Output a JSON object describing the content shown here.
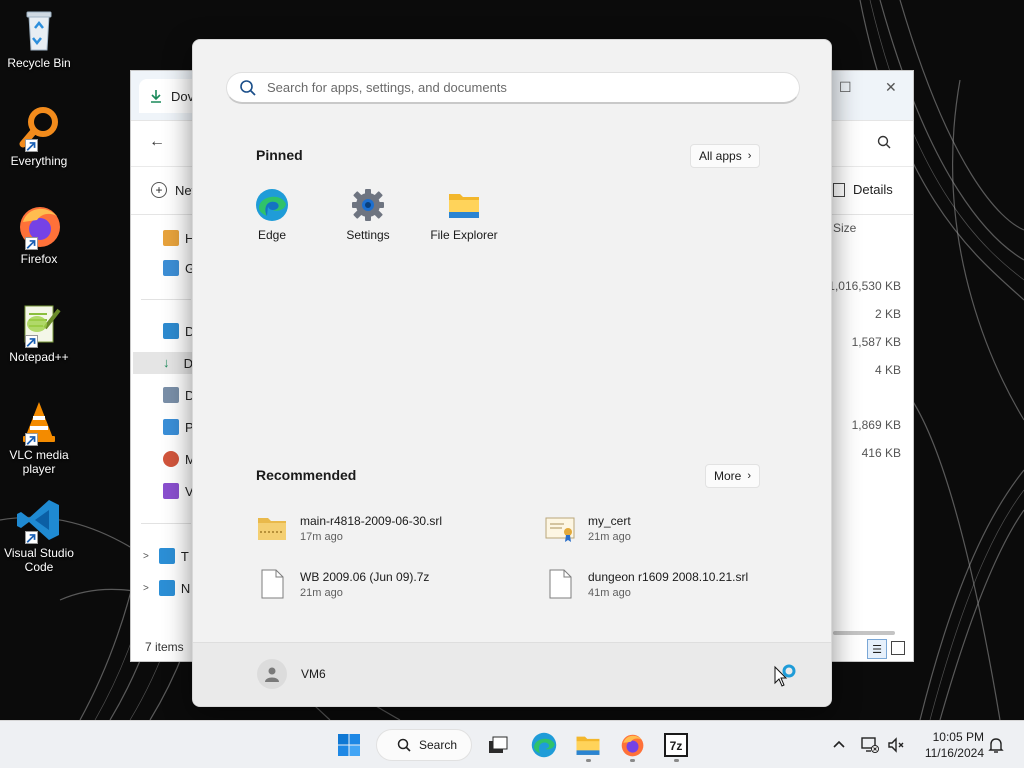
{
  "desktop": {
    "icons": [
      {
        "label": "Recycle Bin",
        "icon": "recycle-bin-icon"
      },
      {
        "label": "Everything",
        "icon": "everything-search-icon"
      },
      {
        "label": "Firefox",
        "icon": "firefox-icon"
      },
      {
        "label": "Notepad++",
        "icon": "notepad-plus-plus-icon"
      },
      {
        "label": "VLC media player",
        "icon": "vlc-icon"
      },
      {
        "label": "Visual Studio Code",
        "icon": "vscode-icon"
      }
    ]
  },
  "explorer": {
    "tab_title": "Dov",
    "new_label": "New",
    "details_label": "Details",
    "size_header": "Size",
    "nav_items": [
      "H",
      "G",
      "D",
      "D",
      "D",
      "P",
      "M",
      "V",
      "T",
      "N"
    ],
    "sizes": [
      "1,016,530 KB",
      "2 KB",
      "1,587 KB",
      "4 KB",
      "1,869 KB",
      "416 KB"
    ],
    "status": "7 items"
  },
  "start_menu": {
    "search_placeholder": "Search for apps, settings, and documents",
    "pinned_title": "Pinned",
    "all_apps_label": "All apps",
    "pinned": [
      {
        "label": "Edge",
        "icon": "edge-icon"
      },
      {
        "label": "Settings",
        "icon": "settings-gear-icon"
      },
      {
        "label": "File Explorer",
        "icon": "file-explorer-icon"
      }
    ],
    "recommended_title": "Recommended",
    "more_label": "More",
    "recommended": [
      {
        "name": "main-r4818-2009-06-30.srl",
        "time": "17m ago",
        "icon": "archive-folder-icon"
      },
      {
        "name": "my_cert",
        "time": "21m ago",
        "icon": "certificate-icon"
      },
      {
        "name": "WB 2009.06 (Jun 09).7z",
        "time": "21m ago",
        "icon": "document-icon"
      },
      {
        "name": "dungeon r1609 2008.10.21.srl",
        "time": "41m ago",
        "icon": "document-icon"
      }
    ],
    "user_name": "VM6"
  },
  "taskbar": {
    "search_label": "Search",
    "time": "10:05 PM",
    "date": "11/16/2024"
  },
  "colors": {
    "accent": "#0067c0",
    "start_bg": "#f2f2f2",
    "taskbar_bg": "#eef0f3"
  }
}
